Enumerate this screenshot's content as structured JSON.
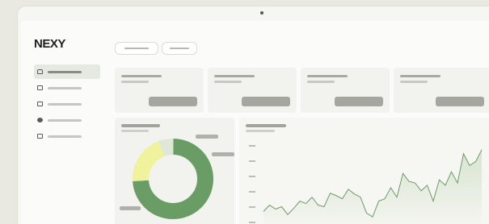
{
  "app": {
    "logo": "NEXY"
  },
  "sidebar": {
    "items": [
      {
        "icon": "home-icon",
        "active": true
      },
      {
        "icon": "inbox-icon",
        "active": false
      },
      {
        "icon": "table-icon",
        "active": false
      },
      {
        "icon": "globe-icon",
        "active": false
      },
      {
        "icon": "card-icon",
        "active": false
      }
    ]
  },
  "colors": {
    "donut_dark": "#6a9d65",
    "donut_light": "#f0f39b",
    "donut_pale": "#dfe8d6",
    "area_stroke": "#6f9b68",
    "area_fill": "#d7e4d0"
  },
  "donut": {
    "segments": [
      0.74,
      0.2,
      0.06
    ]
  },
  "area_series": [
    22,
    30,
    25,
    28,
    18,
    26,
    35,
    32,
    40,
    30,
    28,
    45,
    42,
    38,
    50,
    44,
    40,
    20,
    15,
    35,
    38,
    52,
    40,
    70,
    60,
    58,
    48,
    55,
    35,
    62,
    55,
    72,
    58,
    95,
    80,
    85,
    100
  ]
}
